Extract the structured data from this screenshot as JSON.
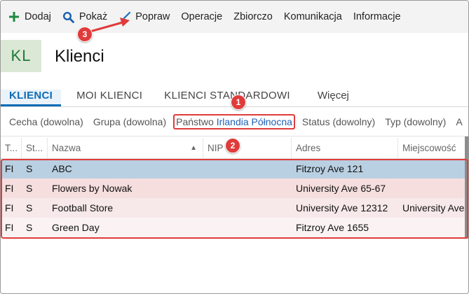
{
  "toolbar": {
    "items": [
      {
        "label": "Dodaj",
        "icon": "plus-icon"
      },
      {
        "label": "Pokaż",
        "icon": "search-icon"
      },
      {
        "label": "Popraw",
        "icon": "brush-icon"
      },
      {
        "label": "Operacje"
      },
      {
        "label": "Zbiorczo"
      },
      {
        "label": "Komunikacja"
      },
      {
        "label": "Informacje"
      }
    ]
  },
  "header": {
    "badge": "KL",
    "title": "Klienci"
  },
  "tabs": [
    {
      "label": "KLIENCI",
      "active": true
    },
    {
      "label": "MOI KLIENCI"
    },
    {
      "label": "KLIENCI STANDARDOWI"
    },
    {
      "label": "Więcej"
    }
  ],
  "filters": [
    {
      "label": "Cecha (dowolna)"
    },
    {
      "label": "Grupa (dowolna)"
    },
    {
      "label": "Państwo",
      "value": "Irlandia Północna"
    },
    {
      "label": "Status (dowolny)"
    },
    {
      "label": "Typ (dowolny)"
    },
    {
      "label": "A"
    }
  ],
  "table": {
    "columns": [
      "T...",
      "St...",
      "Nazwa",
      "NIP",
      "Adres",
      "Miejscowość"
    ],
    "rows": [
      [
        "FI",
        "S",
        "ABC",
        "",
        "Fitzroy Ave 121",
        ""
      ],
      [
        "FI",
        "S",
        "Flowers by Nowak",
        "",
        "University Ave 65-67",
        ""
      ],
      [
        "FI",
        "S",
        "Football Store",
        "",
        "University Ave 12312",
        "University Ave"
      ],
      [
        "FI",
        "S",
        "Green Day",
        "",
        "Fitzroy Ave 1655",
        ""
      ]
    ]
  },
  "callouts": [
    "1",
    "2",
    "3"
  ],
  "colors": {
    "accent": "#0b6bb5",
    "callout": "#e03b3b",
    "badge_bg": "#dbe8d6",
    "badge_text": "#1e7a3a",
    "selected_row": "#b9d0e2"
  }
}
